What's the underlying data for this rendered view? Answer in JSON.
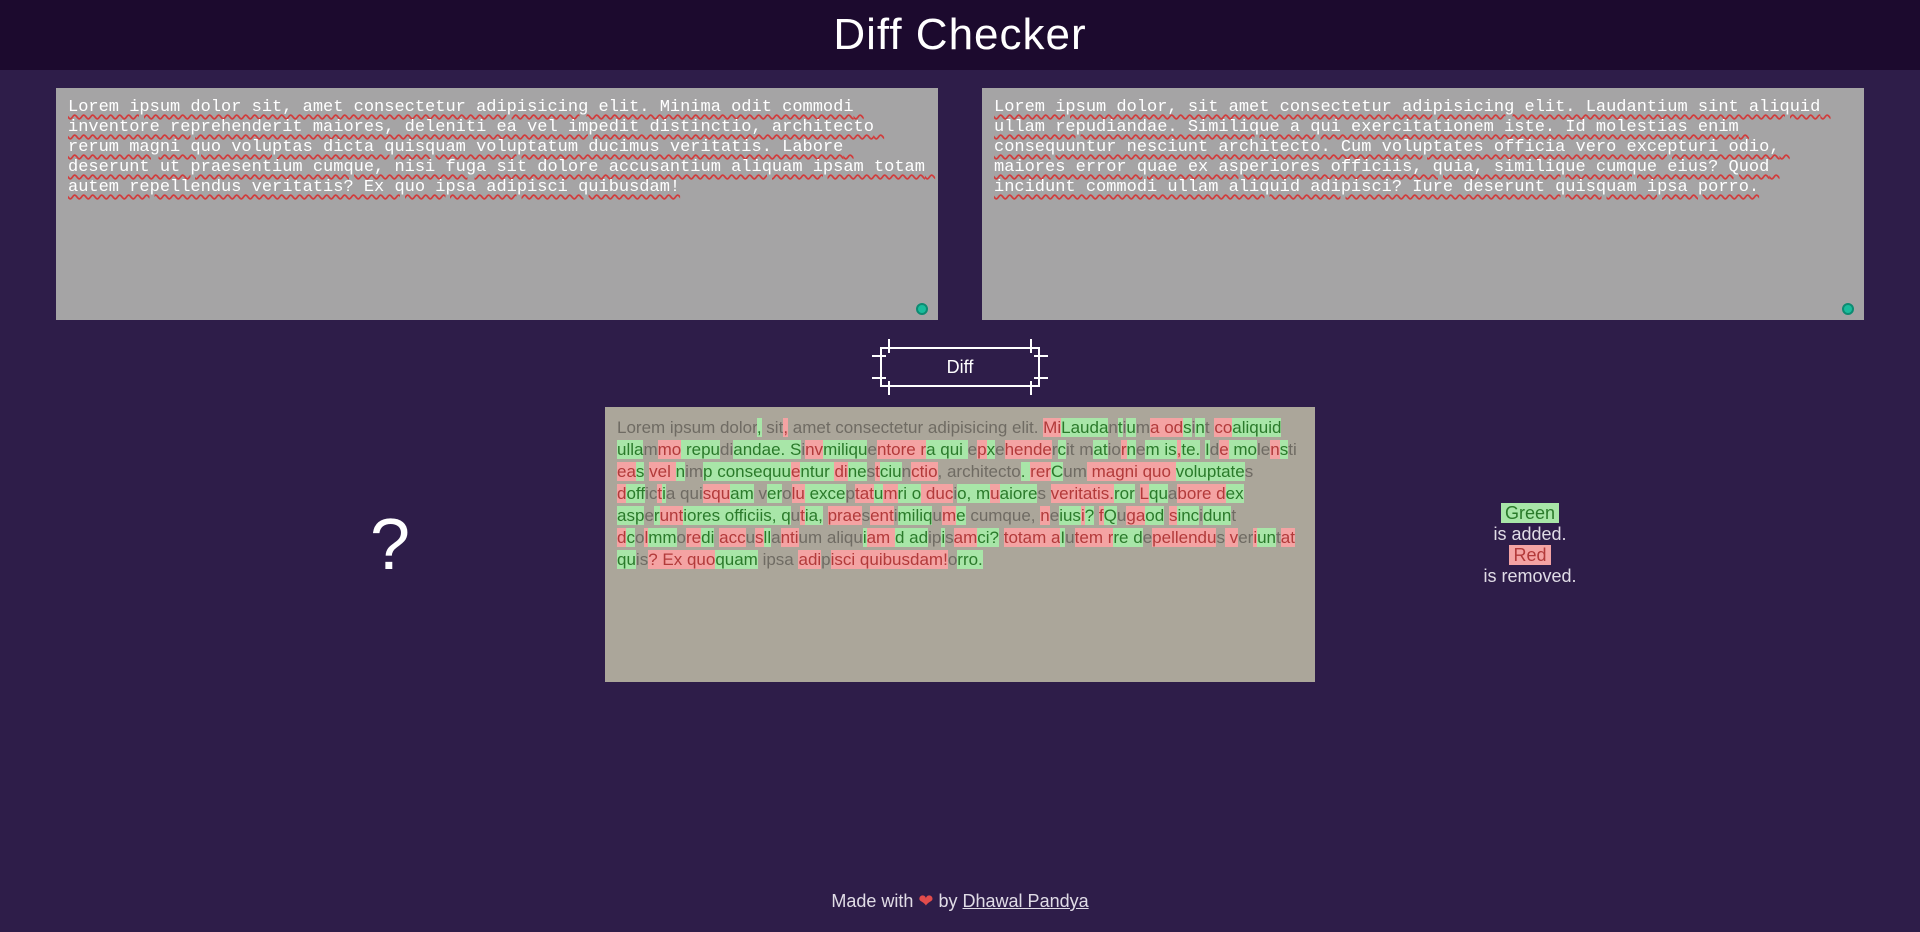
{
  "header": {
    "title": "Diff Checker"
  },
  "inputs": {
    "left": "Lorem ipsum dolor sit, amet consectetur adipisicing elit. Minima odit commodi inventore reprehenderit maiores, deleniti ea vel impedit distinctio, architecto rerum magni quo voluptas dicta quisquam voluptatum ducimus veritatis. Labore deserunt ut praesentium cumque, nisi fuga sit dolore accusantium aliquam ipsam totam autem repellendus veritatis? Ex quo ipsa adipisci quibusdam!",
    "right": "Lorem ipsum dolor, sit amet consectetur adipisicing elit. Laudantium sint aliquid ullam repudiandae. Similique a qui exercitationem iste. Id molestias enim consequuntur nesciunt architecto. Cum voluptates officia vero excepturi odio, maiores error quae ex asperiores officiis, quia, similique cumque eius? Quod incidunt commodi ullam aliquid adipisci? Iure deserunt quisquam ipsa porro."
  },
  "button": {
    "label": "Diff"
  },
  "help": {
    "symbol": "?"
  },
  "legend": {
    "green_label": "Green",
    "green_text": "is added.",
    "red_label": "Red",
    "red_text": "is removed."
  },
  "diff_output": [
    {
      "t": "Lorem ipsum dolor",
      "k": "s"
    },
    {
      "t": ",",
      "k": "a"
    },
    {
      "t": " sit",
      "k": "s"
    },
    {
      "t": ",",
      "k": "r"
    },
    {
      "t": " amet consectetur adipisicing elit. ",
      "k": "s"
    },
    {
      "t": "Mi",
      "k": "r"
    },
    {
      "t": "Lauda",
      "k": "a"
    },
    {
      "t": "n",
      "k": "s"
    },
    {
      "t": "t",
      "k": "a"
    },
    {
      "t": "i",
      "k": "s"
    },
    {
      "t": "u",
      "k": "a"
    },
    {
      "t": "m",
      "k": "s"
    },
    {
      "t": "a od",
      "k": "r"
    },
    {
      "t": "s",
      "k": "a"
    },
    {
      "t": "i",
      "k": "s"
    },
    {
      "t": "n",
      "k": "a"
    },
    {
      "t": "t ",
      "k": "s"
    },
    {
      "t": "co",
      "k": "r"
    },
    {
      "t": "aliquid ulla",
      "k": "a"
    },
    {
      "t": "m",
      "k": "s"
    },
    {
      "t": "mo",
      "k": "r"
    },
    {
      "t": " repu",
      "k": "a"
    },
    {
      "t": "di",
      "k": "s"
    },
    {
      "t": "andae. S",
      "k": "a"
    },
    {
      "t": "i",
      "k": "s"
    },
    {
      "t": "nv",
      "k": "r"
    },
    {
      "t": "miliqu",
      "k": "a"
    },
    {
      "t": "e",
      "k": "s"
    },
    {
      "t": "ntore r",
      "k": "r"
    },
    {
      "t": "a qui ",
      "k": "a"
    },
    {
      "t": "e",
      "k": "s"
    },
    {
      "t": "p",
      "k": "r"
    },
    {
      "t": "x",
      "k": "a"
    },
    {
      "t": "e",
      "k": "s"
    },
    {
      "t": "hende",
      "k": "r"
    },
    {
      "t": "r",
      "k": "s"
    },
    {
      "t": "c",
      "k": "a"
    },
    {
      "t": "it m",
      "k": "s"
    },
    {
      "t": "at",
      "k": "a"
    },
    {
      "t": "io",
      "k": "s"
    },
    {
      "t": "r",
      "k": "r"
    },
    {
      "t": "n",
      "k": "a"
    },
    {
      "t": "e",
      "k": "s"
    },
    {
      "t": "m is",
      "k": "a"
    },
    {
      "t": ",",
      "k": "r"
    },
    {
      "t": "te.",
      "k": "a"
    },
    {
      "t": " ",
      "k": "s"
    },
    {
      "t": "I",
      "k": "a"
    },
    {
      "t": "d",
      "k": "s"
    },
    {
      "t": "e",
      "k": "r"
    },
    {
      "t": " mo",
      "k": "a"
    },
    {
      "t": "le",
      "k": "s"
    },
    {
      "t": "n",
      "k": "r"
    },
    {
      "t": "s",
      "k": "a"
    },
    {
      "t": "ti",
      "k": "s"
    },
    {
      "t": " ea",
      "k": "r"
    },
    {
      "t": "s",
      "k": "a"
    },
    {
      "t": " ",
      "k": "s"
    },
    {
      "t": "ve",
      "k": "r"
    },
    {
      "t": "l ",
      "k": "r"
    },
    {
      "t": "n",
      "k": "a"
    },
    {
      "t": "im",
      "k": "s"
    },
    {
      "t": "p consequu",
      "k": "a"
    },
    {
      "t": "e",
      "k": "r"
    },
    {
      "t": "n",
      "k": "a"
    },
    {
      "t": "tur ",
      "k": "a"
    },
    {
      "t": "di",
      "k": "r"
    },
    {
      "t": "ne",
      "k": "a"
    },
    {
      "t": "s",
      "k": "s"
    },
    {
      "t": "t",
      "k": "r"
    },
    {
      "t": "ci",
      "k": "a"
    },
    {
      "t": "u",
      "k": "a"
    },
    {
      "t": "n",
      "k": "s"
    },
    {
      "t": "ct",
      "k": "r"
    },
    {
      "t": "io",
      "k": "r"
    },
    {
      "t": ", architect",
      "k": "s"
    },
    {
      "t": "o",
      "k": "s"
    },
    {
      "t": ". ",
      "k": "a"
    },
    {
      "t": "re",
      "k": "r"
    },
    {
      "t": "r",
      "k": "r"
    },
    {
      "t": "C",
      "k": "a"
    },
    {
      "t": "um",
      "k": "s"
    },
    {
      "t": " magni quo ",
      "k": "r"
    },
    {
      "t": "voluptat",
      "k": "a"
    },
    {
      "t": "e",
      "k": "a"
    },
    {
      "t": "s ",
      "k": "s"
    },
    {
      "t": "d",
      "k": "r"
    },
    {
      "t": "off",
      "k": "a"
    },
    {
      "t": "ic",
      "k": "s"
    },
    {
      "t": "t",
      "k": "r"
    },
    {
      "t": "i",
      "k": "a"
    },
    {
      "t": "a qui",
      "k": "s"
    },
    {
      "t": "s",
      "k": "r"
    },
    {
      "t": "qu",
      "k": "r"
    },
    {
      "t": "am",
      "k": "a"
    },
    {
      "t": " v",
      "k": "s"
    },
    {
      "t": "e",
      "k": "a"
    },
    {
      "t": "r",
      "k": "a"
    },
    {
      "t": "o",
      "k": "s"
    },
    {
      "t": "lu",
      "k": "r"
    },
    {
      "t": " exce",
      "k": "a"
    },
    {
      "t": "p",
      "k": "s"
    },
    {
      "t": "t",
      "k": "r"
    },
    {
      "t": "at",
      "k": "r"
    },
    {
      "t": "u",
      "k": "a"
    },
    {
      "t": "m",
      "k": "r"
    },
    {
      "t": "ri o",
      "k": "a"
    },
    {
      "t": " d",
      "k": "r"
    },
    {
      "t": "u",
      "k": "r"
    },
    {
      "t": "c",
      "k": "r"
    },
    {
      "t": "i",
      "k": "s"
    },
    {
      "t": "o, m",
      "k": "a"
    },
    {
      "t": "u",
      "k": "r"
    },
    {
      "t": "aiore",
      "k": "a"
    },
    {
      "t": "s ",
      "k": "s"
    },
    {
      "t": "ve",
      "k": "r"
    },
    {
      "t": "r",
      "k": "r"
    },
    {
      "t": "itatis.",
      "k": "r"
    },
    {
      "t": "ror",
      "k": "a"
    },
    {
      "t": " ",
      "k": "s"
    },
    {
      "t": "L",
      "k": "r"
    },
    {
      "t": "qu",
      "k": "a"
    },
    {
      "t": "a",
      "k": "s"
    },
    {
      "t": "b",
      "k": "r"
    },
    {
      "t": "o",
      "k": "r"
    },
    {
      "t": "re ",
      "k": "r"
    },
    {
      "t": "d",
      "k": "r"
    },
    {
      "t": "e",
      "k": "a"
    },
    {
      "t": "x as",
      "k": "a"
    },
    {
      "t": "p",
      "k": "a"
    },
    {
      "t": "e",
      "k": "s"
    },
    {
      "t": "r",
      "k": "a"
    },
    {
      "t": "un",
      "k": "r"
    },
    {
      "t": "t",
      "k": "r"
    },
    {
      "t": "iores officiis, ",
      "k": "a"
    },
    {
      "t": "q",
      "k": "a"
    },
    {
      "t": "u",
      "k": "s"
    },
    {
      "t": "t",
      "k": "r"
    },
    {
      "t": "ia,",
      "k": "a"
    },
    {
      "t": " ",
      "k": "s"
    },
    {
      "t": "prae",
      "k": "r"
    },
    {
      "t": "s",
      "k": "s"
    },
    {
      "t": "ent",
      "k": "r"
    },
    {
      "t": "i",
      "k": "s"
    },
    {
      "t": "mili",
      "k": "a"
    },
    {
      "t": "q",
      "k": "a"
    },
    {
      "t": "u",
      "k": "s"
    },
    {
      "t": "m",
      "k": "r"
    },
    {
      "t": "e",
      "k": "a"
    },
    {
      "t": " cumque, ",
      "k": "s"
    },
    {
      "t": "n",
      "k": "r"
    },
    {
      "t": "e",
      "k": "s"
    },
    {
      "t": "i",
      "k": "a"
    },
    {
      "t": "us",
      "k": "a"
    },
    {
      "t": "i",
      "k": "r"
    },
    {
      "t": "?",
      "k": "a"
    },
    {
      "t": " ",
      "k": "s"
    },
    {
      "t": "f",
      "k": "r"
    },
    {
      "t": "Q",
      "k": "a"
    },
    {
      "t": "u",
      "k": "s"
    },
    {
      "t": "ga",
      "k": "r"
    },
    {
      "t": "od",
      "k": "a"
    },
    {
      "t": " ",
      "k": "s"
    },
    {
      "t": "s",
      "k": "r"
    },
    {
      "t": "inc",
      "k": "a"
    },
    {
      "t": "i",
      "k": "s"
    },
    {
      "t": "dun",
      "k": "a"
    },
    {
      "t": "t ",
      "k": "s"
    },
    {
      "t": "d",
      "k": "r"
    },
    {
      "t": "c",
      "k": "a"
    },
    {
      "t": "o",
      "k": "s"
    },
    {
      "t": "l",
      "k": "r"
    },
    {
      "t": "mm",
      "k": "a"
    },
    {
      "t": "o",
      "k": "s"
    },
    {
      "t": "re",
      "k": "r"
    },
    {
      "t": "di",
      "k": "a"
    },
    {
      "t": " ",
      "k": "s"
    },
    {
      "t": "acc",
      "k": "r"
    },
    {
      "t": "u",
      "k": "s"
    },
    {
      "t": "s",
      "k": "r"
    },
    {
      "t": "ll",
      "k": "a"
    },
    {
      "t": "a",
      "k": "s"
    },
    {
      "t": "nt",
      "k": "r"
    },
    {
      "t": "i",
      "k": "r"
    },
    {
      "t": "um aliqu",
      "k": "s"
    },
    {
      "t": "i",
      "k": "a"
    },
    {
      "t": "am",
      "k": "r"
    },
    {
      "t": " ",
      "k": "r"
    },
    {
      "t": "d",
      "k": "a"
    },
    {
      "t": " ",
      "k": "a"
    },
    {
      "t": "a",
      "k": "a"
    },
    {
      "t": "d",
      "k": "a"
    },
    {
      "t": "i",
      "k": "s"
    },
    {
      "t": "p",
      "k": "s"
    },
    {
      "t": "i",
      "k": "a"
    },
    {
      "t": "s",
      "k": "s"
    },
    {
      "t": "am",
      "k": "r"
    },
    {
      "t": "ci?",
      "k": "a"
    },
    {
      "t": " ",
      "k": "s"
    },
    {
      "t": "totam a",
      "k": "r"
    },
    {
      "t": "I",
      "k": "a"
    },
    {
      "t": "u",
      "k": "s"
    },
    {
      "t": "t",
      "k": "r"
    },
    {
      "t": "em",
      "k": "r"
    },
    {
      "t": " r",
      "k": "r"
    },
    {
      "t": "re ",
      "k": "a"
    },
    {
      "t": "d",
      "k": "a"
    },
    {
      "t": "e",
      "k": "s"
    },
    {
      "t": "p",
      "k": "r"
    },
    {
      "t": "ellendu",
      "k": "r"
    },
    {
      "t": "s",
      "k": "s"
    },
    {
      "t": " v",
      "k": "r"
    },
    {
      "t": "er",
      "k": "s"
    },
    {
      "t": "i",
      "k": "r"
    },
    {
      "t": "un",
      "k": "a"
    },
    {
      "t": "t",
      "k": "s"
    },
    {
      "t": "at",
      "k": "r"
    },
    {
      "t": " qu",
      "k": "a"
    },
    {
      "t": "is",
      "k": "s"
    },
    {
      "t": "? Ex quo",
      "k": "r"
    },
    {
      "t": "quam",
      "k": "a"
    },
    {
      "t": " ipsa ",
      "k": "s"
    },
    {
      "t": "adi",
      "k": "r"
    },
    {
      "t": "p",
      "k": "s"
    },
    {
      "t": "isci quibusdam!",
      "k": "r"
    },
    {
      "t": "o",
      "k": "s"
    },
    {
      "t": "rro.",
      "k": "a"
    }
  ],
  "footer": {
    "prefix": "Made with ",
    "heart": "❤",
    "by": " by ",
    "author": "Dhawal Pandya"
  }
}
